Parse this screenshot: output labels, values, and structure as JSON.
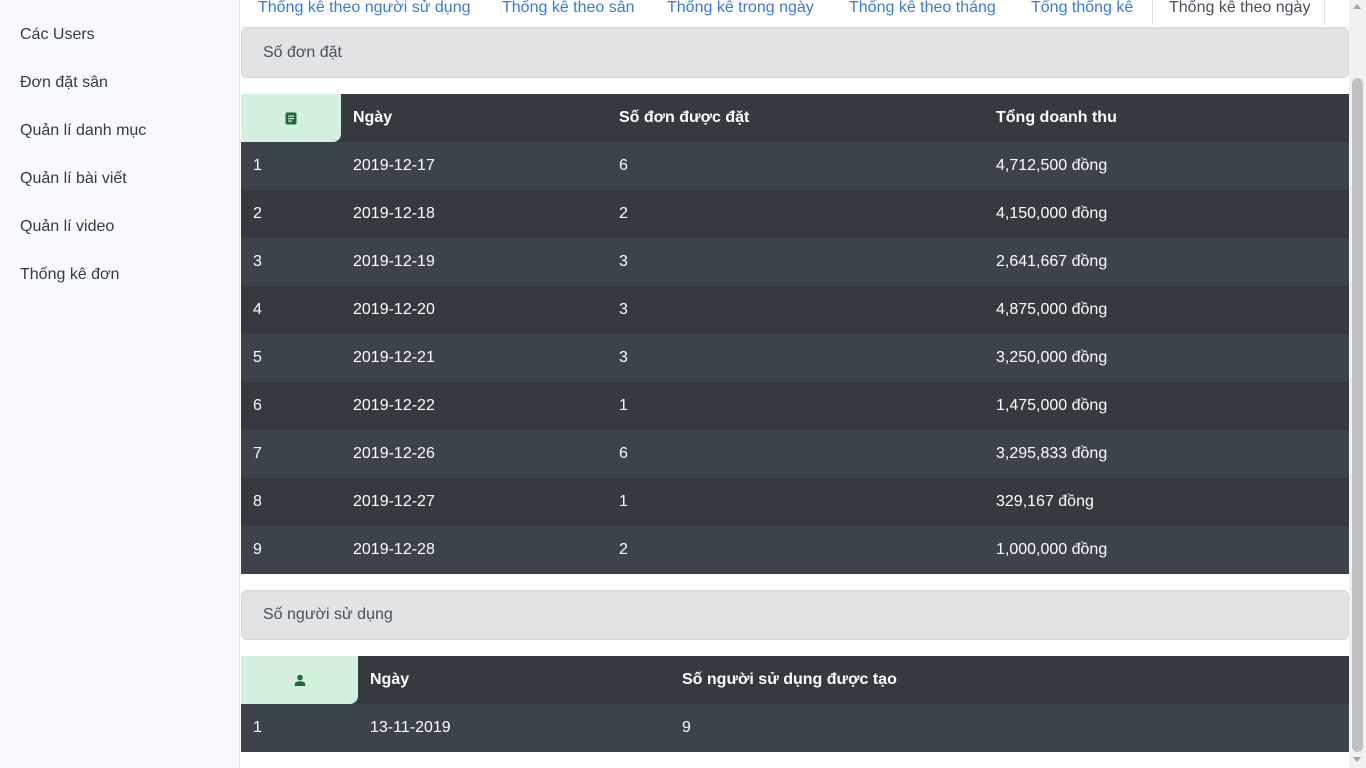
{
  "sidebar": {
    "items": [
      {
        "label": "Các Users"
      },
      {
        "label": "Đơn đặt sân"
      },
      {
        "label": "Quản lí danh mục"
      },
      {
        "label": "Quản lí bài viết"
      },
      {
        "label": "Quản lí video"
      },
      {
        "label": "Thống kê đơn"
      }
    ]
  },
  "tabs": [
    {
      "label": "Thống kê theo người sử dụng"
    },
    {
      "label": "Thống kê theo sân"
    },
    {
      "label": "Thống kê trong ngày"
    },
    {
      "label": "Thống kê theo tháng"
    },
    {
      "label": "Tổng thống kê"
    },
    {
      "label": "Thống kê theo ngày",
      "active": true
    }
  ],
  "orders": {
    "header": "Số đơn đặt",
    "icon": "document-icon",
    "columns": [
      "Ngày",
      "Số đơn được đặt",
      "Tổng doanh thu"
    ],
    "rows": [
      [
        "1",
        "2019-12-17",
        "6",
        "4,712,500 đồng"
      ],
      [
        "2",
        "2019-12-18",
        "2",
        "4,150,000 đồng"
      ],
      [
        "3",
        "2019-12-19",
        "3",
        "2,641,667 đồng"
      ],
      [
        "4",
        "2019-12-20",
        "3",
        "4,875,000 đồng"
      ],
      [
        "5",
        "2019-12-21",
        "3",
        "3,250,000 đồng"
      ],
      [
        "6",
        "2019-12-22",
        "1",
        "1,475,000 đồng"
      ],
      [
        "7",
        "2019-12-26",
        "6",
        "3,295,833 đồng"
      ],
      [
        "8",
        "2019-12-27",
        "1",
        "329,167 đồng"
      ],
      [
        "9",
        "2019-12-28",
        "2",
        "1,000,000 đồng"
      ]
    ]
  },
  "users": {
    "header": "Số người sử dụng",
    "icon": "user-icon",
    "columns": [
      "Ngày",
      "Số người sử dụng được tạo"
    ],
    "rows": [
      [
        "1",
        "13-11-2019",
        "9"
      ]
    ]
  },
  "colors": {
    "table_bg": "#343a40",
    "table_alt": "#3d434a",
    "icon_bg": "#d4f1df",
    "icon_fg": "#1e6b3a",
    "tab_link": "#3a7bd5"
  }
}
